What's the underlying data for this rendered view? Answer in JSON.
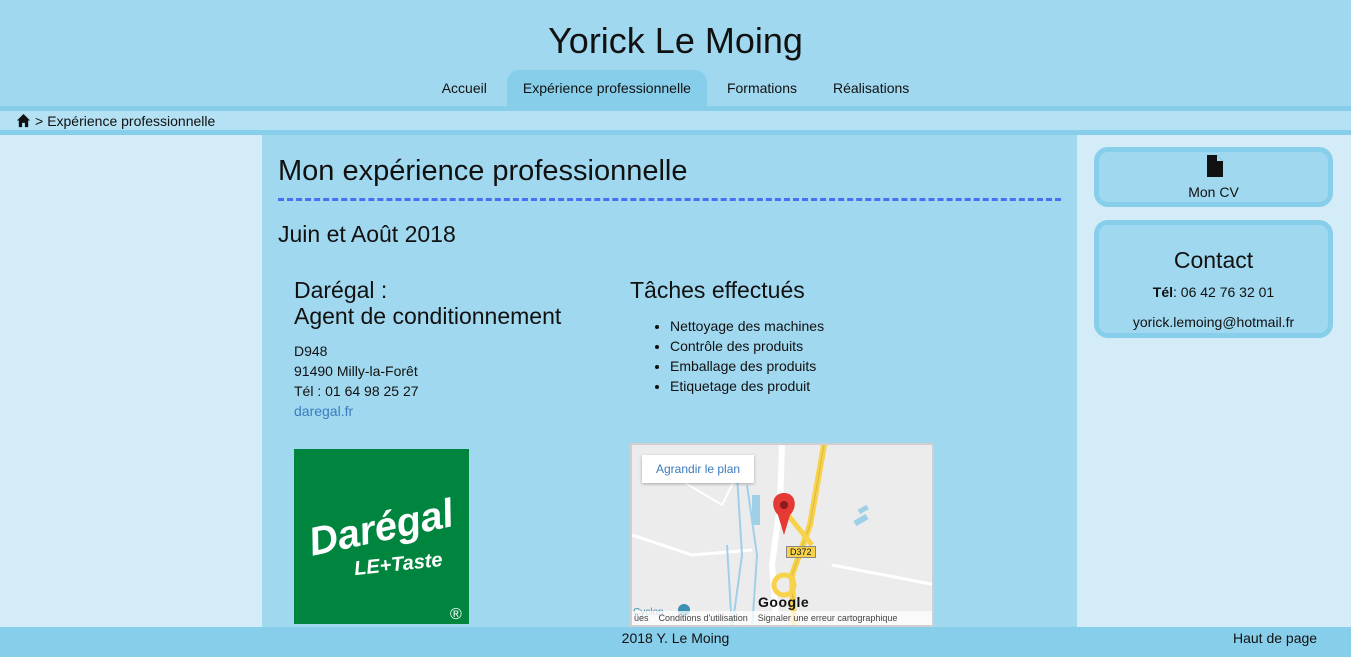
{
  "header": {
    "title": "Yorick Le Moing",
    "nav": [
      {
        "label": "Accueil"
      },
      {
        "label": "Expérience professionnelle"
      },
      {
        "label": "Formations"
      },
      {
        "label": "Réalisations"
      }
    ]
  },
  "breadcrumb": {
    "separator": ">",
    "current": "Expérience professionnelle"
  },
  "main": {
    "title": "Mon expérience professionnelle",
    "period": "Juin et Août 2018",
    "company": {
      "name_line1": "Darégal :",
      "name_line2": "Agent de conditionnement",
      "address1": "D948",
      "address2": "91490 Milly-la-Forêt",
      "phone": "Tél : 01 64 98 25 27",
      "website": "daregal.fr"
    },
    "tasks": {
      "title": "Tâches effectués",
      "items": [
        "Nettoyage des machines",
        "Contrôle des produits",
        "Emballage des produits",
        "Etiquetage des produit"
      ]
    },
    "logo": {
      "brand": "Darégal",
      "tagline": "LE+Taste",
      "mark": "®",
      "color": "#00853f"
    },
    "map": {
      "enlarge_button": "Agrandir le plan",
      "road_label": "D372",
      "google": "Google",
      "place": "Cyclop",
      "footer_left": "ües",
      "terms": "Conditions d'utilisation",
      "report": "Signaler une erreur cartographique"
    }
  },
  "sidebar": {
    "cv_label": "Mon CV",
    "contact_title": "Contact",
    "phone_label": "Tél",
    "phone": ": 06 42 76 32 01",
    "email": "yorick.lemoing@hotmail.fr"
  },
  "footer": {
    "copyright": "2018 Y. Le Moing",
    "back_to_top": "Haut de page"
  },
  "colors": {
    "header_bg": "#a0d8ef",
    "accent": "#87ceeb",
    "page_bg": "#d3ecf7",
    "link": "#3b7bbf",
    "rule": "#4a6ff5"
  }
}
